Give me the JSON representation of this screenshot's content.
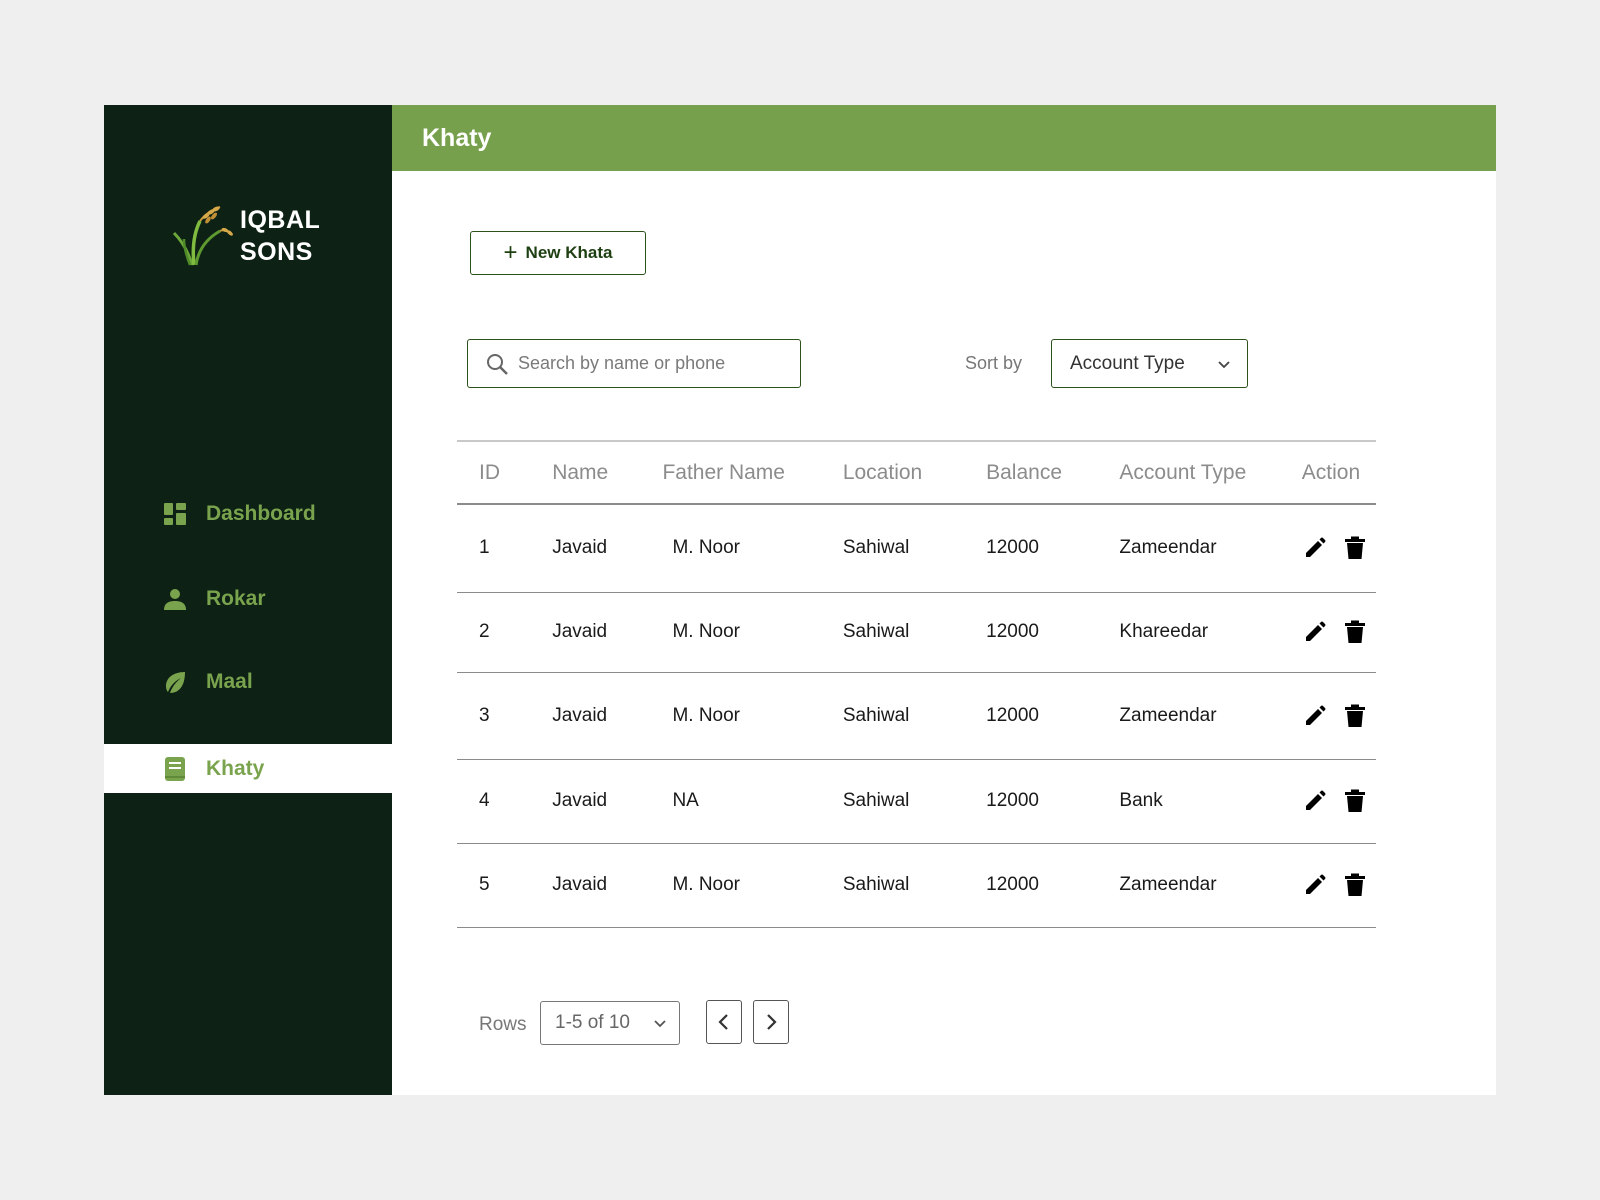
{
  "brand": {
    "line1": "IQBAL",
    "line2": "SONS"
  },
  "sidebar": {
    "items": [
      {
        "label": "Dashboard",
        "icon": "dashboard-icon",
        "active": false
      },
      {
        "label": "Rokar",
        "icon": "person-icon",
        "active": false
      },
      {
        "label": "Maal",
        "icon": "leaf-icon",
        "active": false
      },
      {
        "label": "Khaty",
        "icon": "ledger-icon",
        "active": true
      }
    ]
  },
  "header": {
    "title": "Khaty"
  },
  "toolbar": {
    "new_label": "New Khata",
    "search_placeholder": "Search by name or phone",
    "sort_label": "Sort by",
    "sort_value": "Account Type"
  },
  "table": {
    "columns": [
      "ID",
      "Name",
      "Father Name",
      "Location",
      "Balance",
      "Account Type",
      "Action"
    ],
    "rows": [
      {
        "id": "1",
        "name": "Javaid",
        "father": "M. Noor",
        "location": "Sahiwal",
        "balance": "12000",
        "type": "Zameendar"
      },
      {
        "id": "2",
        "name": "Javaid",
        "father": "M. Noor",
        "location": "Sahiwal",
        "balance": "12000",
        "type": "Khareedar"
      },
      {
        "id": "3",
        "name": "Javaid",
        "father": "M. Noor",
        "location": "Sahiwal",
        "balance": "12000",
        "type": "Zameendar"
      },
      {
        "id": "4",
        "name": "Javaid",
        "father": "NA",
        "location": "Sahiwal",
        "balance": "12000",
        "type": "Bank"
      },
      {
        "id": "5",
        "name": "Javaid",
        "father": "M. Noor",
        "location": "Sahiwal",
        "balance": "12000",
        "type": "Zameendar"
      }
    ]
  },
  "pagination": {
    "rows_label": "Rows",
    "range": "1-5 of 10"
  },
  "colors": {
    "sidebar_bg": "#0d2114",
    "accent_green": "#76a04b",
    "nav_text": "#7aa34e",
    "border_dark_green": "#2b5218"
  }
}
